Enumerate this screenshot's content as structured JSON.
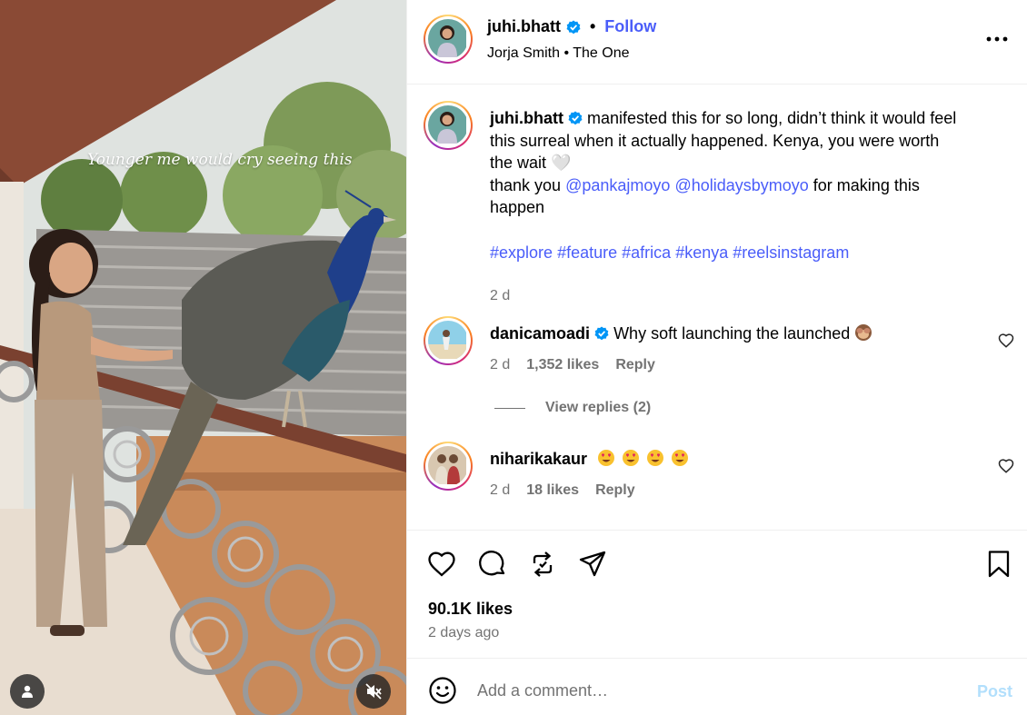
{
  "media": {
    "overlay_text": "Younger me would cry seeing this",
    "tags_icon": "user-tag-icon",
    "mute_icon": "speaker-muted-icon"
  },
  "header": {
    "username": "juhi.bhatt",
    "verified": true,
    "follow_label": "Follow",
    "separator": "•",
    "audio_artist": "Jorja Smith",
    "audio_title": "The One",
    "more_icon": "more-horizontal-icon"
  },
  "caption": {
    "username": "juhi.bhatt",
    "text_1": "manifested this for so long, didn’t think it would feel this surreal when it actually happened. Kenya, you were worth the wait",
    "heart_emoji": "🤍",
    "text_2": "thank you",
    "mention_1": "@pankajmoyo",
    "mention_2": "@holidaysbymoyo",
    "text_3": "for making this happen",
    "hashtags": [
      "#explore",
      "#feature",
      "#africa",
      "#kenya",
      "#reelsinstagram"
    ],
    "time": "2 d"
  },
  "comments": [
    {
      "username": "danicamoadi",
      "verified": true,
      "text": "Why soft launching the launched",
      "emoji": "see-no-evil-monkey-icon",
      "time": "2 d",
      "likes": "1,352 likes",
      "reply_label": "Reply"
    },
    {
      "username": "niharikakaur",
      "verified": false,
      "text": "",
      "emoji": "heart-eyes-face-icon",
      "emoji_count": 4,
      "time": "2 d",
      "likes": "18 likes",
      "reply_label": "Reply"
    }
  ],
  "view_replies_label": "View replies (2)",
  "actions": {
    "like_icon": "heart-icon",
    "comment_icon": "comment-bubble-icon",
    "repost_icon": "repost-icon",
    "share_icon": "paper-plane-icon",
    "save_icon": "bookmark-icon"
  },
  "likes_count": "90.1K likes",
  "posted_ago": "2 days ago",
  "composer": {
    "placeholder": "Add a comment…",
    "post_label": "Post"
  },
  "colors": {
    "link": "#4a5df9",
    "secondary_text": "#737373",
    "post_disabled": "#b2dffc",
    "verified_badge": "#0095f6"
  }
}
